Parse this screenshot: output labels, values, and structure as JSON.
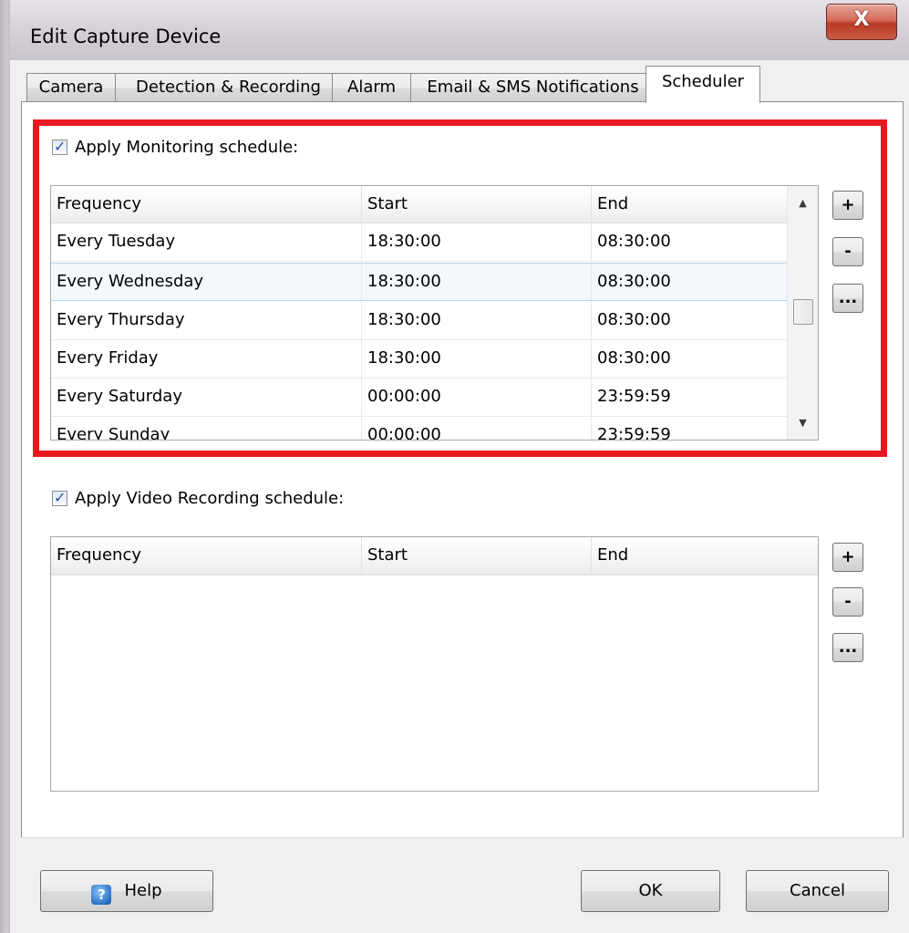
{
  "window": {
    "title": "Edit Capture Device",
    "close_glyph": "X"
  },
  "tabs": [
    {
      "label": "Camera",
      "active": false
    },
    {
      "label": "Detection & Recording",
      "active": false
    },
    {
      "label": "Alarm",
      "active": false
    },
    {
      "label": "Email & SMS Notifications",
      "active": false
    },
    {
      "label": "Scheduler",
      "active": true
    }
  ],
  "monitoring": {
    "checkbox_label": "Apply Monitoring schedule:",
    "checked": true,
    "columns": [
      "Frequency",
      "Start",
      "End"
    ],
    "rows": [
      {
        "frequency": "Every Tuesday",
        "start": "18:30:00",
        "end": "08:30:00"
      },
      {
        "frequency": "Every Wednesday",
        "start": "18:30:00",
        "end": "08:30:00"
      },
      {
        "frequency": "Every Thursday",
        "start": "18:30:00",
        "end": "08:30:00"
      },
      {
        "frequency": "Every Friday",
        "start": "18:30:00",
        "end": "08:30:00"
      },
      {
        "frequency": "Every Saturday",
        "start": "00:00:00",
        "end": "23:59:59"
      },
      {
        "frequency": "Every Sunday",
        "start": "00:00:00",
        "end": "23:59:59"
      }
    ],
    "selected_row": "Every Wednesday",
    "buttons": {
      "add": "+",
      "remove": "-",
      "edit": "..."
    }
  },
  "recording": {
    "checkbox_label": "Apply Video Recording schedule:",
    "checked": true,
    "columns": [
      "Frequency",
      "Start",
      "End"
    ],
    "rows": [],
    "buttons": {
      "add": "+",
      "remove": "-",
      "edit": "..."
    }
  },
  "footer": {
    "help_label": "Help",
    "help_icon_glyph": "?",
    "ok_label": "OK",
    "cancel_label": "Cancel"
  },
  "colors": {
    "highlight_border": "#e81820",
    "close_button": "#c75a44"
  }
}
